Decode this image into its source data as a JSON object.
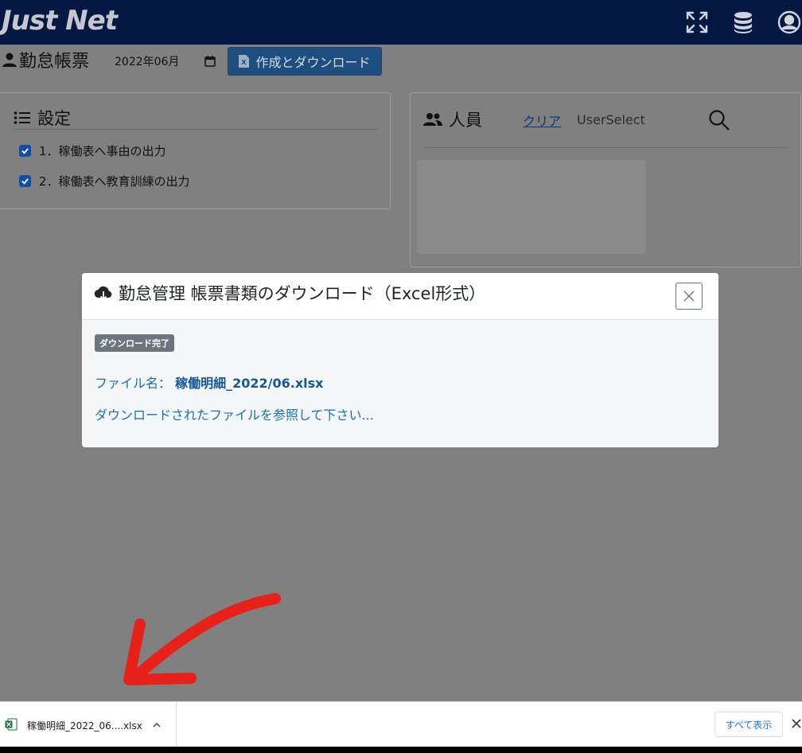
{
  "navbar": {
    "logo_text": "Just Net",
    "icons": [
      "fullscreen-icon",
      "database-icon",
      "user-circle-icon"
    ]
  },
  "page": {
    "title": "勤怠帳票",
    "month_value": "2022年06月",
    "export_button_label": "作成とダウンロード"
  },
  "settings_card": {
    "title": "設定",
    "options": [
      {
        "label": "1．稼働表へ事由の出力",
        "checked": true
      },
      {
        "label": "2．稼働表へ教育訓練の出力",
        "checked": true
      }
    ]
  },
  "people_card": {
    "title": "人員",
    "clear_link": "クリア",
    "user_select": "UserSelect"
  },
  "modal": {
    "title": "勤怠管理 帳票書類のダウンロード（Excel形式）",
    "badge": "ダウンロード完了",
    "file_label": "ファイル名：",
    "file_name": "稼働明細_2022/06.xlsx",
    "message": "ダウンロードされたファイルを参照して下さい..."
  },
  "download_bar": {
    "file_name": "稼働明細_2022_06....xlsx",
    "show_all_label": "すべて表示"
  },
  "colors": {
    "navbar": "#051844",
    "overlay": "#808080",
    "export_button": "#1e4d7f",
    "link_blue": "#1b6fb5",
    "badge_gray": "#6c757d",
    "annotation_red": "#e8201a"
  }
}
